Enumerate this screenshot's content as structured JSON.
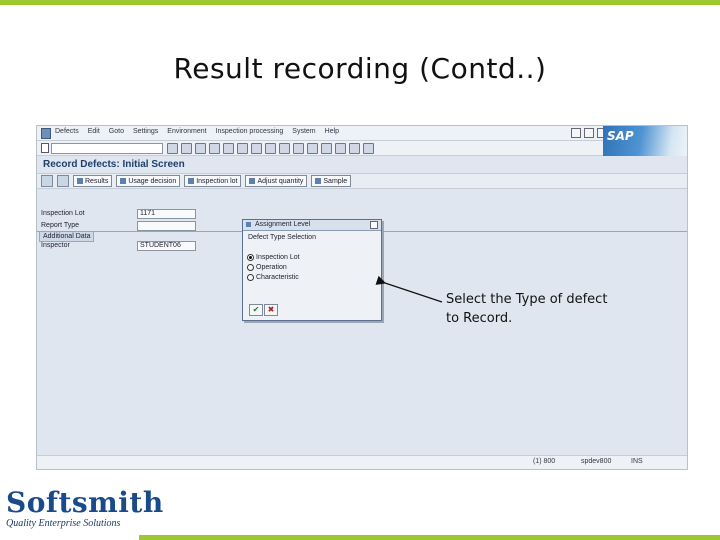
{
  "slide": {
    "title": "Result recording (Contd..)",
    "callout": "Select the Type of defect to Record.",
    "logo": {
      "brand": "Softsmith",
      "tagline": "Quality Enterprise Solutions"
    },
    "accent_color": "#9dc92f"
  },
  "sap": {
    "menu": [
      "Defects",
      "Edit",
      "Goto",
      "Settings",
      "Environment",
      "Inspection processing",
      "System",
      "Help"
    ],
    "logo_text": "SAP",
    "screen_title": "Record Defects: Initial Screen",
    "app_toolbar": [
      {
        "icon": "results-icon",
        "label": "Results"
      },
      {
        "icon": "usage-decision-icon",
        "label": "Usage decision"
      },
      {
        "icon": "inspection-lot-icon",
        "label": "Inspection lot"
      },
      {
        "icon": "adjust-quantity-icon",
        "label": "Adjust quantity"
      },
      {
        "icon": "sample-icon",
        "label": "Sample"
      }
    ],
    "fields": [
      {
        "label": "Inspection Lot",
        "value": "1171"
      },
      {
        "label": "Report Type",
        "value": ""
      }
    ],
    "additional_data": {
      "title": "Additional Data",
      "label": "Inspector",
      "value": "STUDENT06"
    },
    "dialog": {
      "title": "Assignment Level",
      "subtitle": "Defect Type Selection",
      "options": [
        {
          "label": "Inspection Lot",
          "selected": true
        },
        {
          "label": "Operation",
          "selected": false
        },
        {
          "label": "Characteristic",
          "selected": false
        }
      ],
      "ok_symbol": "✔",
      "cancel_symbol": "✖"
    },
    "status": {
      "session": "(1) 800",
      "server": "spdev800",
      "mode": "INS"
    }
  }
}
